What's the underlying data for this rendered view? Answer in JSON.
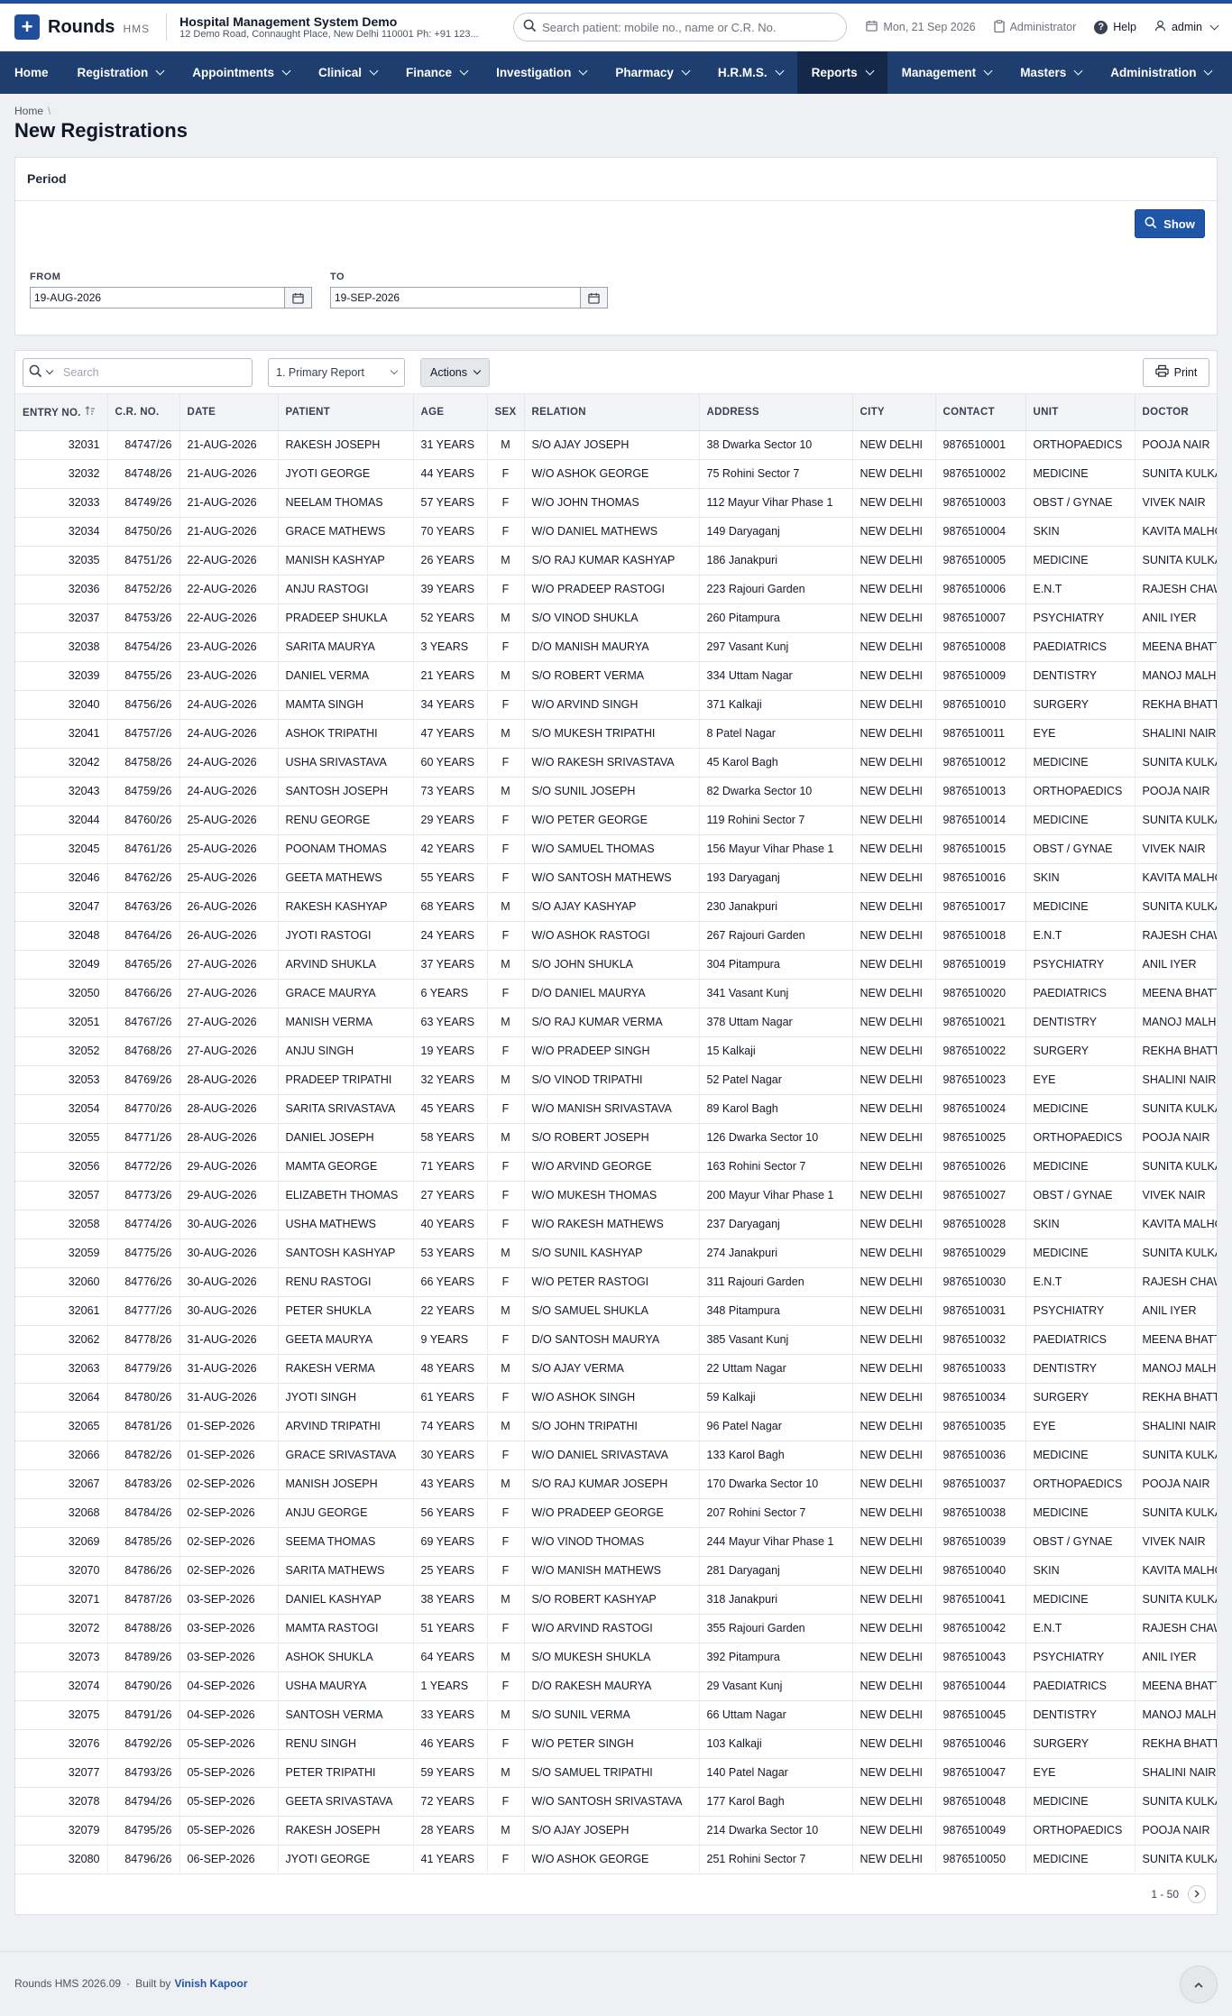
{
  "app": {
    "name": "Rounds",
    "suffix": "HMS"
  },
  "hospital": {
    "name": "Hospital Management System Demo",
    "address": "12 Demo Road, Connaught Place, New Delhi 110001 Ph: +91 123..."
  },
  "search": {
    "placeholder": "Search patient: mobile no., name or C.R. No."
  },
  "header": {
    "date": "Mon, 21 Sep 2026",
    "role": "Administrator",
    "help": "Help",
    "user": "admin"
  },
  "nav": [
    {
      "label": "Home",
      "dropdown": false,
      "active": false
    },
    {
      "label": "Registration",
      "dropdown": true,
      "active": false
    },
    {
      "label": "Appointments",
      "dropdown": true,
      "active": false
    },
    {
      "label": "Clinical",
      "dropdown": true,
      "active": false
    },
    {
      "label": "Finance",
      "dropdown": true,
      "active": false
    },
    {
      "label": "Investigation",
      "dropdown": true,
      "active": false
    },
    {
      "label": "Pharmacy",
      "dropdown": true,
      "active": false
    },
    {
      "label": "H.R.M.S.",
      "dropdown": true,
      "active": false
    },
    {
      "label": "Reports",
      "dropdown": true,
      "active": true
    },
    {
      "label": "Management",
      "dropdown": true,
      "active": false
    },
    {
      "label": "Masters",
      "dropdown": true,
      "active": false
    },
    {
      "label": "Administration",
      "dropdown": true,
      "active": false
    }
  ],
  "breadcrumb": {
    "home": "Home",
    "sep": "\\"
  },
  "page": {
    "title": "New Registrations"
  },
  "period": {
    "title": "Period",
    "show_label": "Show",
    "from_label": "FROM",
    "from_value": "19-AUG-2026",
    "to_label": "TO",
    "to_value": "19-SEP-2026"
  },
  "toolbar": {
    "search_placeholder": "Search",
    "report_select": "1. Primary Report",
    "actions_label": "Actions",
    "print_label": "Print"
  },
  "table": {
    "columns": [
      "ENTRY NO.",
      "C.R. NO.",
      "DATE",
      "PATIENT",
      "AGE",
      "SEX",
      "RELATION",
      "ADDRESS",
      "CITY",
      "CONTACT",
      "UNIT",
      "DOCTOR"
    ],
    "rows": [
      [
        "32031",
        "84747/26",
        "21-AUG-2026",
        "RAKESH JOSEPH",
        "31 YEARS",
        "M",
        "S/O AJAY JOSEPH",
        "38 Dwarka Sector 10",
        "NEW DELHI",
        "9876510001",
        "ORTHOPAEDICS",
        "POOJA NAIR"
      ],
      [
        "32032",
        "84748/26",
        "21-AUG-2026",
        "JYOTI GEORGE",
        "44 YEARS",
        "F",
        "W/O ASHOK GEORGE",
        "75 Rohini Sector 7",
        "NEW DELHI",
        "9876510002",
        "MEDICINE",
        "SUNITA KULKARNI"
      ],
      [
        "32033",
        "84749/26",
        "21-AUG-2026",
        "NEELAM THOMAS",
        "57 YEARS",
        "F",
        "W/O JOHN THOMAS",
        "112 Mayur Vihar Phase 1",
        "NEW DELHI",
        "9876510003",
        "OBST / GYNAE",
        "VIVEK NAIR"
      ],
      [
        "32034",
        "84750/26",
        "21-AUG-2026",
        "GRACE MATHEWS",
        "70 YEARS",
        "F",
        "W/O DANIEL MATHEWS",
        "149 Daryaganj",
        "NEW DELHI",
        "9876510004",
        "SKIN",
        "KAVITA MALHOTRA"
      ],
      [
        "32035",
        "84751/26",
        "22-AUG-2026",
        "MANISH KASHYAP",
        "26 YEARS",
        "M",
        "S/O RAJ KUMAR KASHYAP",
        "186 Janakpuri",
        "NEW DELHI",
        "9876510005",
        "MEDICINE",
        "SUNITA KULKARNI"
      ],
      [
        "32036",
        "84752/26",
        "22-AUG-2026",
        "ANJU RASTOGI",
        "39 YEARS",
        "F",
        "W/O PRADEEP RASTOGI",
        "223 Rajouri Garden",
        "NEW DELHI",
        "9876510006",
        "E.N.T",
        "RAJESH CHAWLA"
      ],
      [
        "32037",
        "84753/26",
        "22-AUG-2026",
        "PRADEEP SHUKLA",
        "52 YEARS",
        "M",
        "S/O VINOD SHUKLA",
        "260 Pitampura",
        "NEW DELHI",
        "9876510007",
        "PSYCHIATRY",
        "ANIL IYER"
      ],
      [
        "32038",
        "84754/26",
        "23-AUG-2026",
        "SARITA MAURYA",
        "3 YEARS",
        "F",
        "D/O MANISH MAURYA",
        "297 Vasant Kunj",
        "NEW DELHI",
        "9876510008",
        "PAEDIATRICS",
        "MEENA BHATT"
      ],
      [
        "32039",
        "84755/26",
        "23-AUG-2026",
        "DANIEL VERMA",
        "21 YEARS",
        "M",
        "S/O ROBERT VERMA",
        "334 Uttam Nagar",
        "NEW DELHI",
        "9876510009",
        "DENTISTRY",
        "MANOJ MALHOTRA"
      ],
      [
        "32040",
        "84756/26",
        "24-AUG-2026",
        "MAMTA SINGH",
        "34 YEARS",
        "F",
        "W/O ARVIND SINGH",
        "371 Kalkaji",
        "NEW DELHI",
        "9876510010",
        "SURGERY",
        "REKHA BHATT"
      ],
      [
        "32041",
        "84757/26",
        "24-AUG-2026",
        "ASHOK TRIPATHI",
        "47 YEARS",
        "M",
        "S/O MUKESH TRIPATHI",
        "8 Patel Nagar",
        "NEW DELHI",
        "9876510011",
        "EYE",
        "SHALINI NAIR"
      ],
      [
        "32042",
        "84758/26",
        "24-AUG-2026",
        "USHA SRIVASTAVA",
        "60 YEARS",
        "F",
        "W/O RAKESH SRIVASTAVA",
        "45 Karol Bagh",
        "NEW DELHI",
        "9876510012",
        "MEDICINE",
        "SUNITA KULKARNI"
      ],
      [
        "32043",
        "84759/26",
        "24-AUG-2026",
        "SANTOSH JOSEPH",
        "73 YEARS",
        "M",
        "S/O SUNIL JOSEPH",
        "82 Dwarka Sector 10",
        "NEW DELHI",
        "9876510013",
        "ORTHOPAEDICS",
        "POOJA NAIR"
      ],
      [
        "32044",
        "84760/26",
        "25-AUG-2026",
        "RENU GEORGE",
        "29 YEARS",
        "F",
        "W/O PETER GEORGE",
        "119 Rohini Sector 7",
        "NEW DELHI",
        "9876510014",
        "MEDICINE",
        "SUNITA KULKARNI"
      ],
      [
        "32045",
        "84761/26",
        "25-AUG-2026",
        "POONAM THOMAS",
        "42 YEARS",
        "F",
        "W/O SAMUEL THOMAS",
        "156 Mayur Vihar Phase 1",
        "NEW DELHI",
        "9876510015",
        "OBST / GYNAE",
        "VIVEK NAIR"
      ],
      [
        "32046",
        "84762/26",
        "25-AUG-2026",
        "GEETA MATHEWS",
        "55 YEARS",
        "F",
        "W/O SANTOSH MATHEWS",
        "193 Daryaganj",
        "NEW DELHI",
        "9876510016",
        "SKIN",
        "KAVITA MALHOTRA"
      ],
      [
        "32047",
        "84763/26",
        "26-AUG-2026",
        "RAKESH KASHYAP",
        "68 YEARS",
        "M",
        "S/O AJAY KASHYAP",
        "230 Janakpuri",
        "NEW DELHI",
        "9876510017",
        "MEDICINE",
        "SUNITA KULKARNI"
      ],
      [
        "32048",
        "84764/26",
        "26-AUG-2026",
        "JYOTI RASTOGI",
        "24 YEARS",
        "F",
        "W/O ASHOK RASTOGI",
        "267 Rajouri Garden",
        "NEW DELHI",
        "9876510018",
        "E.N.T",
        "RAJESH CHAWLA"
      ],
      [
        "32049",
        "84765/26",
        "27-AUG-2026",
        "ARVIND SHUKLA",
        "37 YEARS",
        "M",
        "S/O JOHN SHUKLA",
        "304 Pitampura",
        "NEW DELHI",
        "9876510019",
        "PSYCHIATRY",
        "ANIL IYER"
      ],
      [
        "32050",
        "84766/26",
        "27-AUG-2026",
        "GRACE MAURYA",
        "6 YEARS",
        "F",
        "D/O DANIEL MAURYA",
        "341 Vasant Kunj",
        "NEW DELHI",
        "9876510020",
        "PAEDIATRICS",
        "MEENA BHATT"
      ],
      [
        "32051",
        "84767/26",
        "27-AUG-2026",
        "MANISH VERMA",
        "63 YEARS",
        "M",
        "S/O RAJ KUMAR VERMA",
        "378 Uttam Nagar",
        "NEW DELHI",
        "9876510021",
        "DENTISTRY",
        "MANOJ MALHOTRA"
      ],
      [
        "32052",
        "84768/26",
        "27-AUG-2026",
        "ANJU SINGH",
        "19 YEARS",
        "F",
        "W/O PRADEEP SINGH",
        "15 Kalkaji",
        "NEW DELHI",
        "9876510022",
        "SURGERY",
        "REKHA BHATT"
      ],
      [
        "32053",
        "84769/26",
        "28-AUG-2026",
        "PRADEEP TRIPATHI",
        "32 YEARS",
        "M",
        "S/O VINOD TRIPATHI",
        "52 Patel Nagar",
        "NEW DELHI",
        "9876510023",
        "EYE",
        "SHALINI NAIR"
      ],
      [
        "32054",
        "84770/26",
        "28-AUG-2026",
        "SARITA SRIVASTAVA",
        "45 YEARS",
        "F",
        "W/O MANISH SRIVASTAVA",
        "89 Karol Bagh",
        "NEW DELHI",
        "9876510024",
        "MEDICINE",
        "SUNITA KULKARNI"
      ],
      [
        "32055",
        "84771/26",
        "28-AUG-2026",
        "DANIEL JOSEPH",
        "58 YEARS",
        "M",
        "S/O ROBERT JOSEPH",
        "126 Dwarka Sector 10",
        "NEW DELHI",
        "9876510025",
        "ORTHOPAEDICS",
        "POOJA NAIR"
      ],
      [
        "32056",
        "84772/26",
        "29-AUG-2026",
        "MAMTA GEORGE",
        "71 YEARS",
        "F",
        "W/O ARVIND GEORGE",
        "163 Rohini Sector 7",
        "NEW DELHI",
        "9876510026",
        "MEDICINE",
        "SUNITA KULKARNI"
      ],
      [
        "32057",
        "84773/26",
        "29-AUG-2026",
        "ELIZABETH THOMAS",
        "27 YEARS",
        "F",
        "W/O MUKESH THOMAS",
        "200 Mayur Vihar Phase 1",
        "NEW DELHI",
        "9876510027",
        "OBST / GYNAE",
        "VIVEK NAIR"
      ],
      [
        "32058",
        "84774/26",
        "30-AUG-2026",
        "USHA MATHEWS",
        "40 YEARS",
        "F",
        "W/O RAKESH MATHEWS",
        "237 Daryaganj",
        "NEW DELHI",
        "9876510028",
        "SKIN",
        "KAVITA MALHOTRA"
      ],
      [
        "32059",
        "84775/26",
        "30-AUG-2026",
        "SANTOSH KASHYAP",
        "53 YEARS",
        "M",
        "S/O SUNIL KASHYAP",
        "274 Janakpuri",
        "NEW DELHI",
        "9876510029",
        "MEDICINE",
        "SUNITA KULKARNI"
      ],
      [
        "32060",
        "84776/26",
        "30-AUG-2026",
        "RENU RASTOGI",
        "66 YEARS",
        "F",
        "W/O PETER RASTOGI",
        "311 Rajouri Garden",
        "NEW DELHI",
        "9876510030",
        "E.N.T",
        "RAJESH CHAWLA"
      ],
      [
        "32061",
        "84777/26",
        "30-AUG-2026",
        "PETER SHUKLA",
        "22 YEARS",
        "M",
        "S/O SAMUEL SHUKLA",
        "348 Pitampura",
        "NEW DELHI",
        "9876510031",
        "PSYCHIATRY",
        "ANIL IYER"
      ],
      [
        "32062",
        "84778/26",
        "31-AUG-2026",
        "GEETA MAURYA",
        "9 YEARS",
        "F",
        "D/O SANTOSH MAURYA",
        "385 Vasant Kunj",
        "NEW DELHI",
        "9876510032",
        "PAEDIATRICS",
        "MEENA BHATT"
      ],
      [
        "32063",
        "84779/26",
        "31-AUG-2026",
        "RAKESH VERMA",
        "48 YEARS",
        "M",
        "S/O AJAY VERMA",
        "22 Uttam Nagar",
        "NEW DELHI",
        "9876510033",
        "DENTISTRY",
        "MANOJ MALHOTRA"
      ],
      [
        "32064",
        "84780/26",
        "31-AUG-2026",
        "JYOTI SINGH",
        "61 YEARS",
        "F",
        "W/O ASHOK SINGH",
        "59 Kalkaji",
        "NEW DELHI",
        "9876510034",
        "SURGERY",
        "REKHA BHATT"
      ],
      [
        "32065",
        "84781/26",
        "01-SEP-2026",
        "ARVIND TRIPATHI",
        "74 YEARS",
        "M",
        "S/O JOHN TRIPATHI",
        "96 Patel Nagar",
        "NEW DELHI",
        "9876510035",
        "EYE",
        "SHALINI NAIR"
      ],
      [
        "32066",
        "84782/26",
        "01-SEP-2026",
        "GRACE SRIVASTAVA",
        "30 YEARS",
        "F",
        "W/O DANIEL SRIVASTAVA",
        "133 Karol Bagh",
        "NEW DELHI",
        "9876510036",
        "MEDICINE",
        "SUNITA KULKARNI"
      ],
      [
        "32067",
        "84783/26",
        "02-SEP-2026",
        "MANISH JOSEPH",
        "43 YEARS",
        "M",
        "S/O RAJ KUMAR JOSEPH",
        "170 Dwarka Sector 10",
        "NEW DELHI",
        "9876510037",
        "ORTHOPAEDICS",
        "POOJA NAIR"
      ],
      [
        "32068",
        "84784/26",
        "02-SEP-2026",
        "ANJU GEORGE",
        "56 YEARS",
        "F",
        "W/O PRADEEP GEORGE",
        "207 Rohini Sector 7",
        "NEW DELHI",
        "9876510038",
        "MEDICINE",
        "SUNITA KULKARNI"
      ],
      [
        "32069",
        "84785/26",
        "02-SEP-2026",
        "SEEMA THOMAS",
        "69 YEARS",
        "F",
        "W/O VINOD THOMAS",
        "244 Mayur Vihar Phase 1",
        "NEW DELHI",
        "9876510039",
        "OBST / GYNAE",
        "VIVEK NAIR"
      ],
      [
        "32070",
        "84786/26",
        "02-SEP-2026",
        "SARITA MATHEWS",
        "25 YEARS",
        "F",
        "W/O MANISH MATHEWS",
        "281 Daryaganj",
        "NEW DELHI",
        "9876510040",
        "SKIN",
        "KAVITA MALHOTRA"
      ],
      [
        "32071",
        "84787/26",
        "03-SEP-2026",
        "DANIEL KASHYAP",
        "38 YEARS",
        "M",
        "S/O ROBERT KASHYAP",
        "318 Janakpuri",
        "NEW DELHI",
        "9876510041",
        "MEDICINE",
        "SUNITA KULKARNI"
      ],
      [
        "32072",
        "84788/26",
        "03-SEP-2026",
        "MAMTA RASTOGI",
        "51 YEARS",
        "F",
        "W/O ARVIND RASTOGI",
        "355 Rajouri Garden",
        "NEW DELHI",
        "9876510042",
        "E.N.T",
        "RAJESH CHAWLA"
      ],
      [
        "32073",
        "84789/26",
        "03-SEP-2026",
        "ASHOK SHUKLA",
        "64 YEARS",
        "M",
        "S/O MUKESH SHUKLA",
        "392 Pitampura",
        "NEW DELHI",
        "9876510043",
        "PSYCHIATRY",
        "ANIL IYER"
      ],
      [
        "32074",
        "84790/26",
        "04-SEP-2026",
        "USHA MAURYA",
        "1 YEARS",
        "F",
        "D/O RAKESH MAURYA",
        "29 Vasant Kunj",
        "NEW DELHI",
        "9876510044",
        "PAEDIATRICS",
        "MEENA BHATT"
      ],
      [
        "32075",
        "84791/26",
        "04-SEP-2026",
        "SANTOSH VERMA",
        "33 YEARS",
        "M",
        "S/O SUNIL VERMA",
        "66 Uttam Nagar",
        "NEW DELHI",
        "9876510045",
        "DENTISTRY",
        "MANOJ MALHOTRA"
      ],
      [
        "32076",
        "84792/26",
        "05-SEP-2026",
        "RENU SINGH",
        "46 YEARS",
        "F",
        "W/O PETER SINGH",
        "103 Kalkaji",
        "NEW DELHI",
        "9876510046",
        "SURGERY",
        "REKHA BHATT"
      ],
      [
        "32077",
        "84793/26",
        "05-SEP-2026",
        "PETER TRIPATHI",
        "59 YEARS",
        "M",
        "S/O SAMUEL TRIPATHI",
        "140 Patel Nagar",
        "NEW DELHI",
        "9876510047",
        "EYE",
        "SHALINI NAIR"
      ],
      [
        "32078",
        "84794/26",
        "05-SEP-2026",
        "GEETA SRIVASTAVA",
        "72 YEARS",
        "F",
        "W/O SANTOSH SRIVASTAVA",
        "177 Karol Bagh",
        "NEW DELHI",
        "9876510048",
        "MEDICINE",
        "SUNITA KULKARNI"
      ],
      [
        "32079",
        "84795/26",
        "05-SEP-2026",
        "RAKESH JOSEPH",
        "28 YEARS",
        "M",
        "S/O AJAY JOSEPH",
        "214 Dwarka Sector 10",
        "NEW DELHI",
        "9876510049",
        "ORTHOPAEDICS",
        "POOJA NAIR"
      ],
      [
        "32080",
        "84796/26",
        "06-SEP-2026",
        "JYOTI GEORGE",
        "41 YEARS",
        "F",
        "W/O ASHOK GEORGE",
        "251 Rohini Sector 7",
        "NEW DELHI",
        "9876510050",
        "MEDICINE",
        "SUNITA KULKARNI"
      ]
    ]
  },
  "pager": {
    "range": "1 - 50"
  },
  "footer": {
    "version": "Rounds HMS 2026.09",
    "dot": "·",
    "built_by": "Built by",
    "author": "Vinish Kapoor"
  }
}
